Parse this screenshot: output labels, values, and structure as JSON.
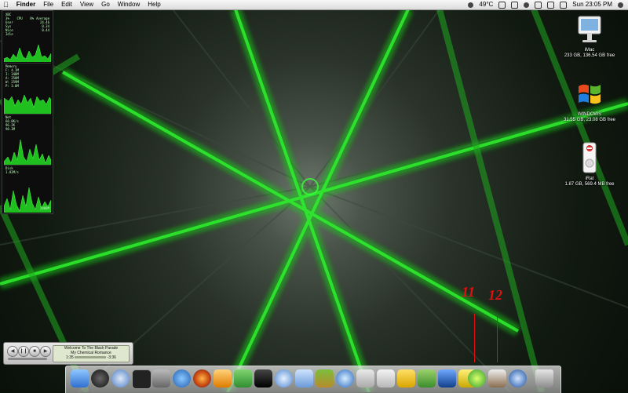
{
  "menubar": {
    "app_name": "Finder",
    "menus": [
      "File",
      "Edit",
      "View",
      "Go",
      "Window",
      "Help"
    ],
    "temperature": "49°C",
    "clock": "Sun 23:05 PM"
  },
  "monitor": {
    "cpu_header": "XBC",
    "cpu_cols": "3%    CPU    8%",
    "cpu_rows": [
      "User",
      "Sys",
      "Nice",
      "Idle"
    ],
    "cpu_avg_label": "Average",
    "cpu_vals": [
      "24.46",
      "0.34",
      "0.44"
    ],
    "memory_label": "Memory",
    "memory_rows": [
      "F: 4.1M",
      "I: 348M",
      "A: 258M",
      "W: 259M",
      "P: 3.0M"
    ],
    "net_label": "Net",
    "net_rows": [
      "60.0K/s",
      "96.2K",
      "98.3M"
    ],
    "disk_label": "Disk",
    "disk_rows": [
      "1.82M/s"
    ],
    "disk_footer": "2800M"
  },
  "desktop_icons": [
    {
      "name": "iMac",
      "detail": "233 GB, 136.54 GB free"
    },
    {
      "name": "WINDOWS",
      "detail": "31.55 GB, 23.08 GB free"
    },
    {
      "name": "iRat",
      "detail": "1.87 GB, 569.4 MB free"
    }
  ],
  "annotations": [
    "11",
    "12"
  ],
  "itunes": {
    "track": "Welcome To The Black Parade",
    "artist": "My Chemical Romance",
    "time_elapsed": "1:35",
    "time_remaining": "-3:36"
  },
  "dock": {
    "items": [
      "finder-icon",
      "dashboard-icon",
      "safari-icon",
      "terminal-icon",
      "system-prefs-icon",
      "browser-icon",
      "firefox-icon",
      "adium-icon",
      "gnome-icon",
      "clapper-icon",
      "itunes-icon",
      "fontbook-icon",
      "pineapple-icon",
      "quicktime-icon",
      "mail-icon",
      "address-book-icon",
      "office-icon",
      "pen-icon",
      "xcode-icon",
      "yellow-app-icon",
      "circle-app-icon",
      "disk-utility-icon",
      "network-icon",
      "trash-icon"
    ]
  }
}
